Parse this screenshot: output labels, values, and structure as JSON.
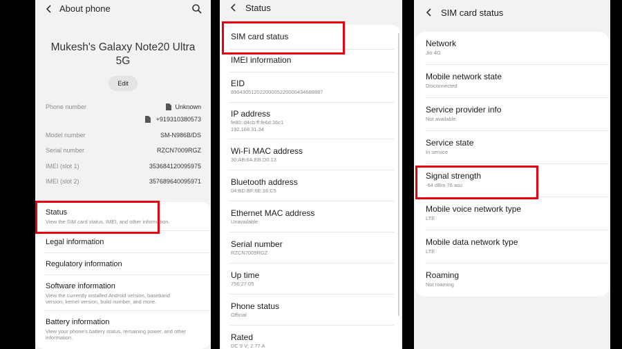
{
  "panel1": {
    "title": "About phone",
    "device_name_line1": "Mukesh's Galaxy Note20 Ultra",
    "device_name_line2": "5G",
    "edit_label": "Edit",
    "info": {
      "phone_number_label": "Phone number",
      "phone_number_value_1": "Unknown",
      "phone_number_value_2": "+919310380573",
      "model_label": "Model number",
      "model_value": "SM-N986B/DS",
      "serial_label": "Serial number",
      "serial_value": "RZCN7009RGZ",
      "imei1_label": "IMEI (slot 1)",
      "imei1_value": "353684120095975",
      "imei2_label": "IMEI (slot 2)",
      "imei2_value": "357689640095971"
    },
    "menu": {
      "status_title": "Status",
      "status_sub": "View the SIM card status, IMEI, and other information.",
      "legal_title": "Legal information",
      "regulatory_title": "Regulatory information",
      "software_title": "Software information",
      "software_sub1": "View the currently installed Android version, baseband",
      "software_sub2": "version, kernel version, build number, and more.",
      "battery_title": "Battery information",
      "battery_sub1": "View your phone's battery status, remaining power, and other",
      "battery_sub2": "information."
    }
  },
  "panel2": {
    "title": "Status",
    "items": [
      {
        "title": "SIM card status",
        "sub": ""
      },
      {
        "title": "IMEI information",
        "sub": ""
      },
      {
        "title": "EID",
        "sub": "89043051202200005220000434688887"
      },
      {
        "title": "IP address",
        "sub": "fe80::d4cb:ff:fe6d:36c1",
        "sub2": "192.168.31.34"
      },
      {
        "title": "Wi-Fi MAC address",
        "sub": "30:AB:6A:EB:D0:13"
      },
      {
        "title": "Bluetooth address",
        "sub": "04:BD:BF:6E:16:C5"
      },
      {
        "title": "Ethernet MAC address",
        "sub": "Unavailable"
      },
      {
        "title": "Serial number",
        "sub": "RZCN7009RGZ"
      },
      {
        "title": "Up time",
        "sub": "756:27:05"
      },
      {
        "title": "Phone status",
        "sub": "Official"
      },
      {
        "title": "Rated",
        "sub": "DC 9 V; 2.77 A"
      }
    ]
  },
  "panel3": {
    "title": "SIM card status",
    "items": [
      {
        "title": "Network",
        "sub": "Jio 4G"
      },
      {
        "title": "Mobile network state",
        "sub": "Disconnected"
      },
      {
        "title": "Service provider info",
        "sub": "Not available."
      },
      {
        "title": "Service state",
        "sub": "In service"
      },
      {
        "title": "Signal strength",
        "sub": "-64 dBm 76 asu"
      },
      {
        "title": "Mobile voice network type",
        "sub": "LTE"
      },
      {
        "title": "Mobile data network type",
        "sub": "LTE"
      },
      {
        "title": "Roaming",
        "sub": "Not roaming"
      }
    ]
  },
  "colors": {
    "highlight": "#e8000f",
    "card": "#ffffff",
    "background": "#f2f2f2"
  },
  "icons": [
    "back-arrow-icon",
    "search-icon",
    "sim-icon"
  ]
}
